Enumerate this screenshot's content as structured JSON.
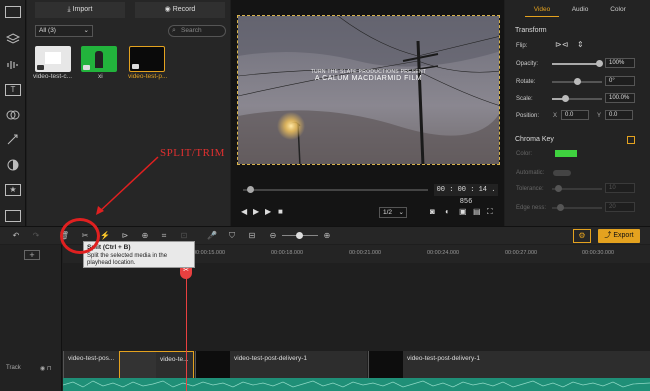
{
  "media": {
    "import_label": "Import",
    "record_label": "Record",
    "filter_value": "All (3)",
    "search_placeholder": "Search",
    "items": [
      {
        "label": "video-test-c..."
      },
      {
        "label": "xi"
      },
      {
        "label": "video-test-p..."
      }
    ]
  },
  "preview": {
    "video_text_line1": "TURN THE SLATE PRODUCTIONS PRESENT",
    "video_text_line2": "A CALUM MACDIARMID FILM",
    "timecode": "00 : 00 : 14 . 856",
    "ratio": "1/2",
    "progress": 0.03
  },
  "properties": {
    "tabs": [
      "Video",
      "Audio",
      "Color"
    ],
    "transform_title": "Transform",
    "flip_label": "Flip:",
    "opacity_label": "Opacity:",
    "opacity_value": "100%",
    "rotate_label": "Rotate:",
    "rotate_value": "0°",
    "scale_label": "Scale:",
    "scale_value": "100.0%",
    "position_label": "Position:",
    "pos_x_label": "X",
    "pos_x_value": "0.0",
    "pos_y_label": "Y",
    "pos_y_value": "0.0",
    "chroma_title": "Chroma Key",
    "color_label": "Color:",
    "automatic_label": "Automatic:",
    "tolerance_label": "Tolerance:",
    "tolerance_value": "10",
    "edge_label": "Edge   ness:",
    "edge_value": "20",
    "chroma_color": "#3fd23f"
  },
  "toolbar": {
    "export_label": "Export"
  },
  "tooltip": {
    "title": "Split (Ctrl + B)",
    "body": "Split the selected media in the playhead location."
  },
  "timeline": {
    "ticks": [
      "00:00:15.000",
      "00:00:18.000",
      "00:00:21.000",
      "00:00:24.000",
      "00:00:27.000",
      "00:00:30.000"
    ],
    "track_label": "Track",
    "clips": [
      {
        "label": "video-test-pos..."
      },
      {
        "label": "video-te..."
      },
      {
        "label": "video-test-post-delivery-1"
      },
      {
        "label": "video-test-post-delivery-1"
      }
    ]
  },
  "annotation": {
    "text": "SPLIT/TRIM"
  },
  "colors": {
    "accent": "#e4a21f",
    "playhead": "#e84040",
    "waveform": "#1f8f77"
  }
}
